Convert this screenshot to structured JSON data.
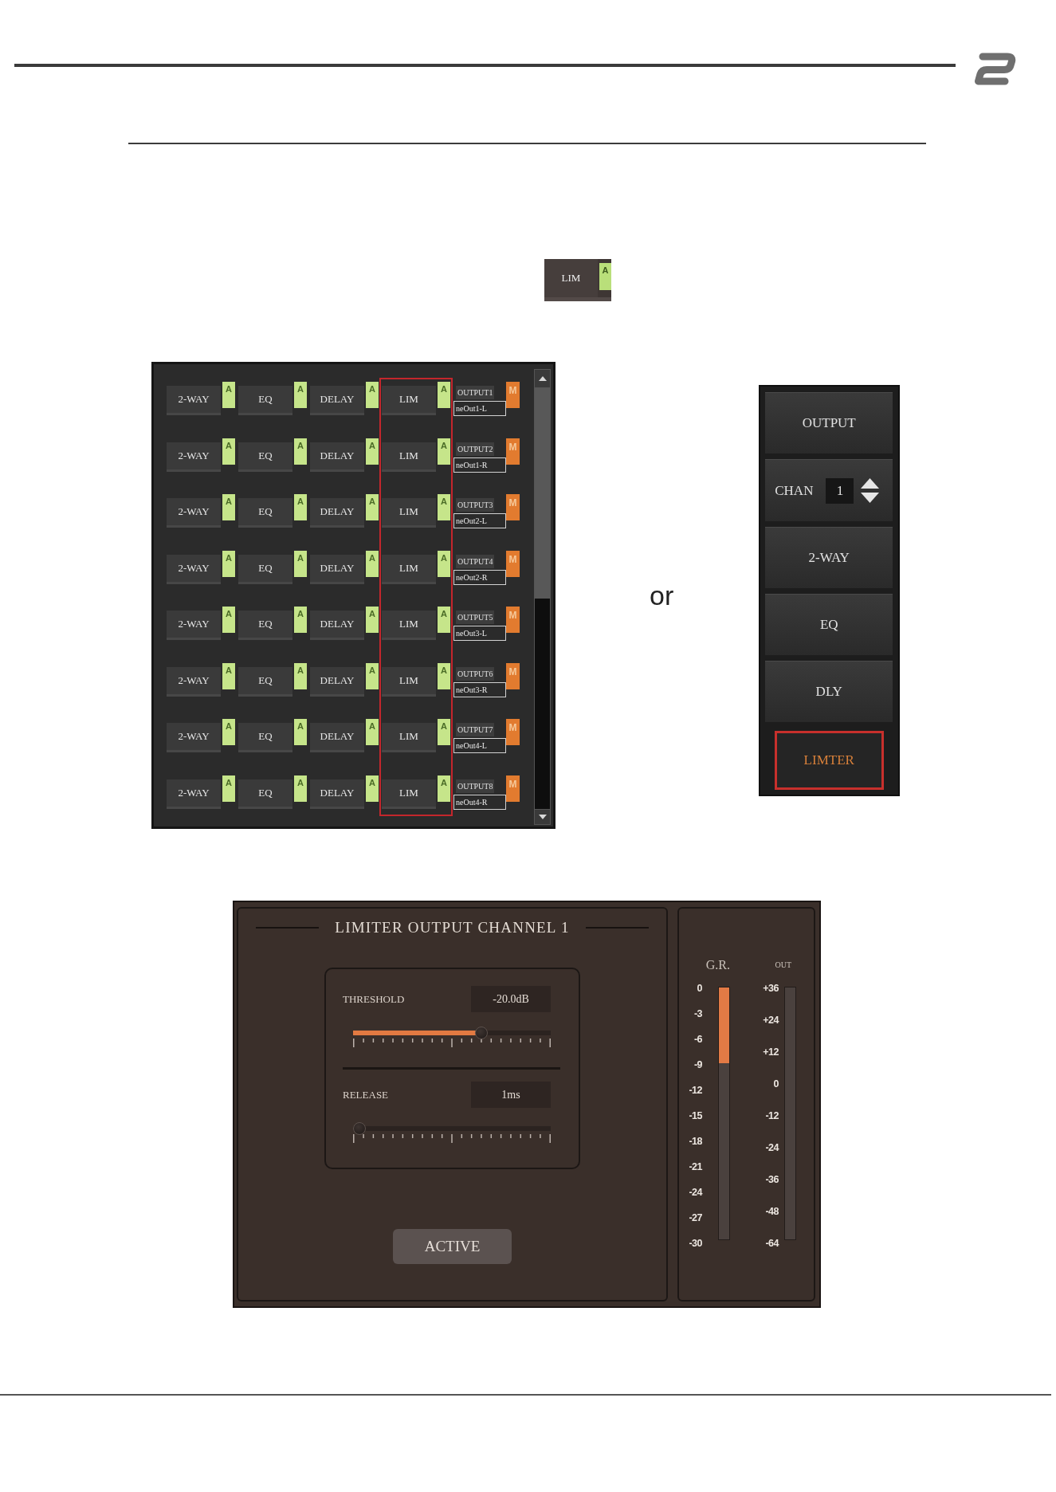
{
  "lim_snippet": {
    "label": "LIM",
    "tag": "A"
  },
  "output_grid": {
    "columns": [
      {
        "highlighted": false
      },
      {
        "highlighted": false
      },
      {
        "highlighted": false
      },
      {
        "highlighted": true
      }
    ],
    "rows": [
      {
        "modules": [
          {
            "label": "2-WAY",
            "tag": "A"
          },
          {
            "label": "EQ",
            "tag": "A"
          },
          {
            "label": "DELAY",
            "tag": "A"
          },
          {
            "label": "LIM",
            "tag": "A"
          }
        ],
        "output": {
          "channel": "OUTPUT1",
          "name": "neOut1-L",
          "mute": "M"
        }
      },
      {
        "modules": [
          {
            "label": "2-WAY",
            "tag": "A"
          },
          {
            "label": "EQ",
            "tag": "A"
          },
          {
            "label": "DELAY",
            "tag": "A"
          },
          {
            "label": "LIM",
            "tag": "A"
          }
        ],
        "output": {
          "channel": "OUTPUT2",
          "name": "neOut1-R",
          "mute": "M"
        }
      },
      {
        "modules": [
          {
            "label": "2-WAY",
            "tag": "A"
          },
          {
            "label": "EQ",
            "tag": "A"
          },
          {
            "label": "DELAY",
            "tag": "A"
          },
          {
            "label": "LIM",
            "tag": "A"
          }
        ],
        "output": {
          "channel": "OUTPUT3",
          "name": "neOut2-L",
          "mute": "M"
        }
      },
      {
        "modules": [
          {
            "label": "2-WAY",
            "tag": "A"
          },
          {
            "label": "EQ",
            "tag": "A"
          },
          {
            "label": "DELAY",
            "tag": "A"
          },
          {
            "label": "LIM",
            "tag": "A"
          }
        ],
        "output": {
          "channel": "OUTPUT4",
          "name": "neOut2-R",
          "mute": "M"
        }
      },
      {
        "modules": [
          {
            "label": "2-WAY",
            "tag": "A"
          },
          {
            "label": "EQ",
            "tag": "A"
          },
          {
            "label": "DELAY",
            "tag": "A"
          },
          {
            "label": "LIM",
            "tag": "A"
          }
        ],
        "output": {
          "channel": "OUTPUT5",
          "name": "neOut3-L",
          "mute": "M"
        }
      },
      {
        "modules": [
          {
            "label": "2-WAY",
            "tag": "A"
          },
          {
            "label": "EQ",
            "tag": "A"
          },
          {
            "label": "DELAY",
            "tag": "A"
          },
          {
            "label": "LIM",
            "tag": "A"
          }
        ],
        "output": {
          "channel": "OUTPUT6",
          "name": "neOut3-R",
          "mute": "M"
        }
      },
      {
        "modules": [
          {
            "label": "2-WAY",
            "tag": "A"
          },
          {
            "label": "EQ",
            "tag": "A"
          },
          {
            "label": "DELAY",
            "tag": "A"
          },
          {
            "label": "LIM",
            "tag": "A"
          }
        ],
        "output": {
          "channel": "OUTPUT7",
          "name": "neOut4-L",
          "mute": "M"
        }
      },
      {
        "modules": [
          {
            "label": "2-WAY",
            "tag": "A"
          },
          {
            "label": "EQ",
            "tag": "A"
          },
          {
            "label": "DELAY",
            "tag": "A"
          },
          {
            "label": "LIM",
            "tag": "A"
          }
        ],
        "output": {
          "channel": "OUTPUT8",
          "name": "neOut4-R",
          "mute": "M"
        }
      }
    ]
  },
  "separator": "or",
  "side_menu": {
    "items": [
      {
        "kind": "button",
        "label": "OUTPUT",
        "selected": false
      },
      {
        "kind": "channel",
        "label": "CHAN",
        "value": "1",
        "selected": false
      },
      {
        "kind": "button",
        "label": "2-WAY",
        "selected": false
      },
      {
        "kind": "button",
        "label": "EQ",
        "selected": false
      },
      {
        "kind": "button",
        "label": "DLY",
        "selected": false
      },
      {
        "kind": "button",
        "label": "LIMTER",
        "selected": true
      }
    ]
  },
  "limiter": {
    "title": "LIMITER OUTPUT CHANNEL 1",
    "controls": [
      {
        "label": "THRESHOLD",
        "value": "-20.0dB",
        "level": 0.66
      },
      {
        "label": "RELEASE",
        "value": "1ms",
        "level": 0
      }
    ],
    "button": "ACTIVE",
    "meters": [
      {
        "kind": "reduction",
        "label": "G.R.",
        "scale": [
          "0",
          "-3",
          "-6",
          "-9",
          "-12",
          "-15",
          "-18",
          "-21",
          "-24",
          "-27",
          "-30"
        ],
        "level": 0.3
      },
      {
        "kind": "output",
        "label": "OUT",
        "scale": [
          "+36",
          "+24",
          "+12",
          "0",
          "-12",
          "-24",
          "-36",
          "-48",
          "-64"
        ]
      }
    ]
  }
}
